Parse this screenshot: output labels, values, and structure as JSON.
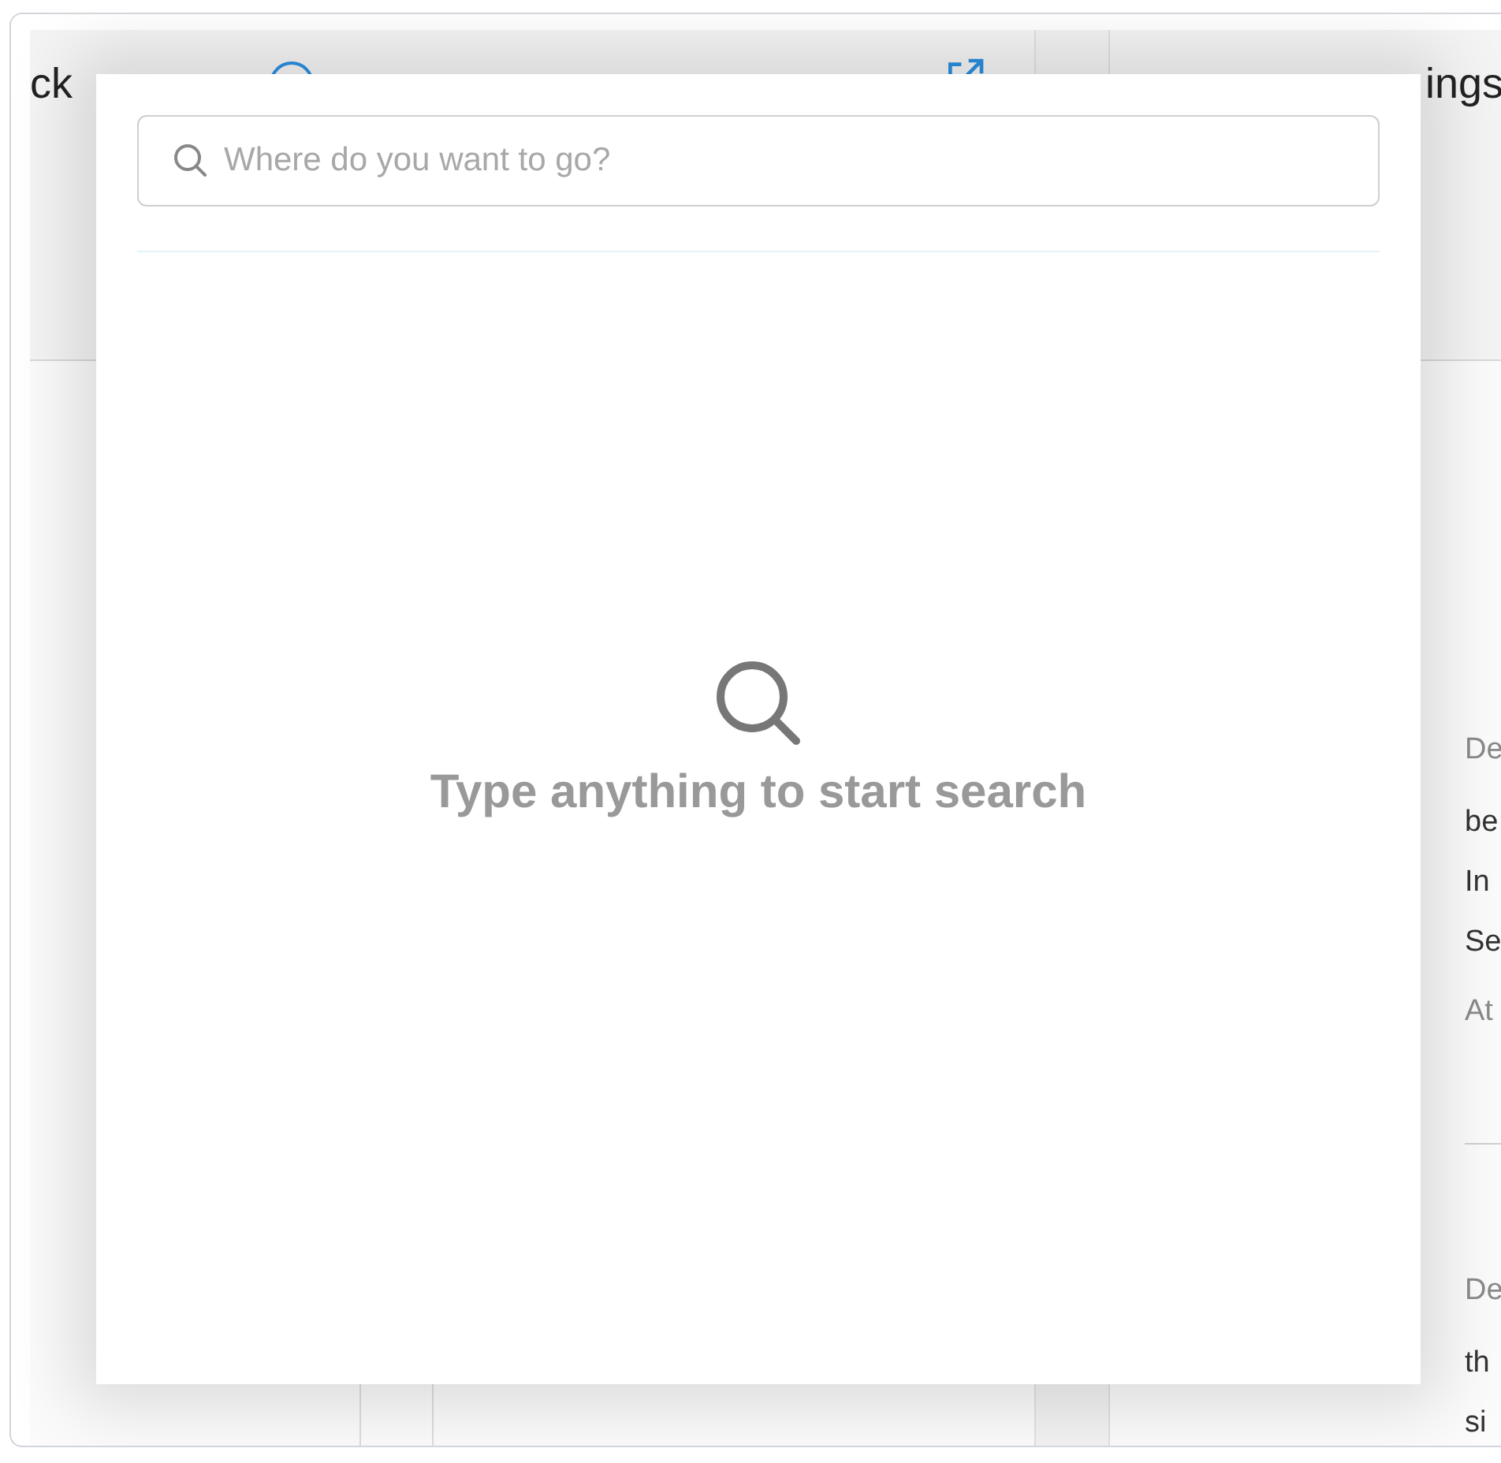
{
  "background": {
    "left_panel": {
      "title": "ck"
    },
    "right_panel": {
      "title": "ings",
      "sections": [
        {
          "lines": [
            {
              "text": "De",
              "kind": "label"
            },
            {
              "text": "be",
              "kind": "body"
            },
            {
              "text": "In",
              "kind": "body"
            },
            {
              "text": "Se",
              "kind": "body"
            },
            {
              "text": "At",
              "kind": "label"
            }
          ]
        },
        {
          "lines": [
            {
              "text": "De",
              "kind": "label"
            },
            {
              "text": "th",
              "kind": "body"
            },
            {
              "text": "si",
              "kind": "body"
            }
          ]
        }
      ]
    }
  },
  "search_dialog": {
    "search": {
      "placeholder": "Where do you want to go?"
    },
    "empty_state": {
      "message": "Type anything to start search"
    }
  }
}
